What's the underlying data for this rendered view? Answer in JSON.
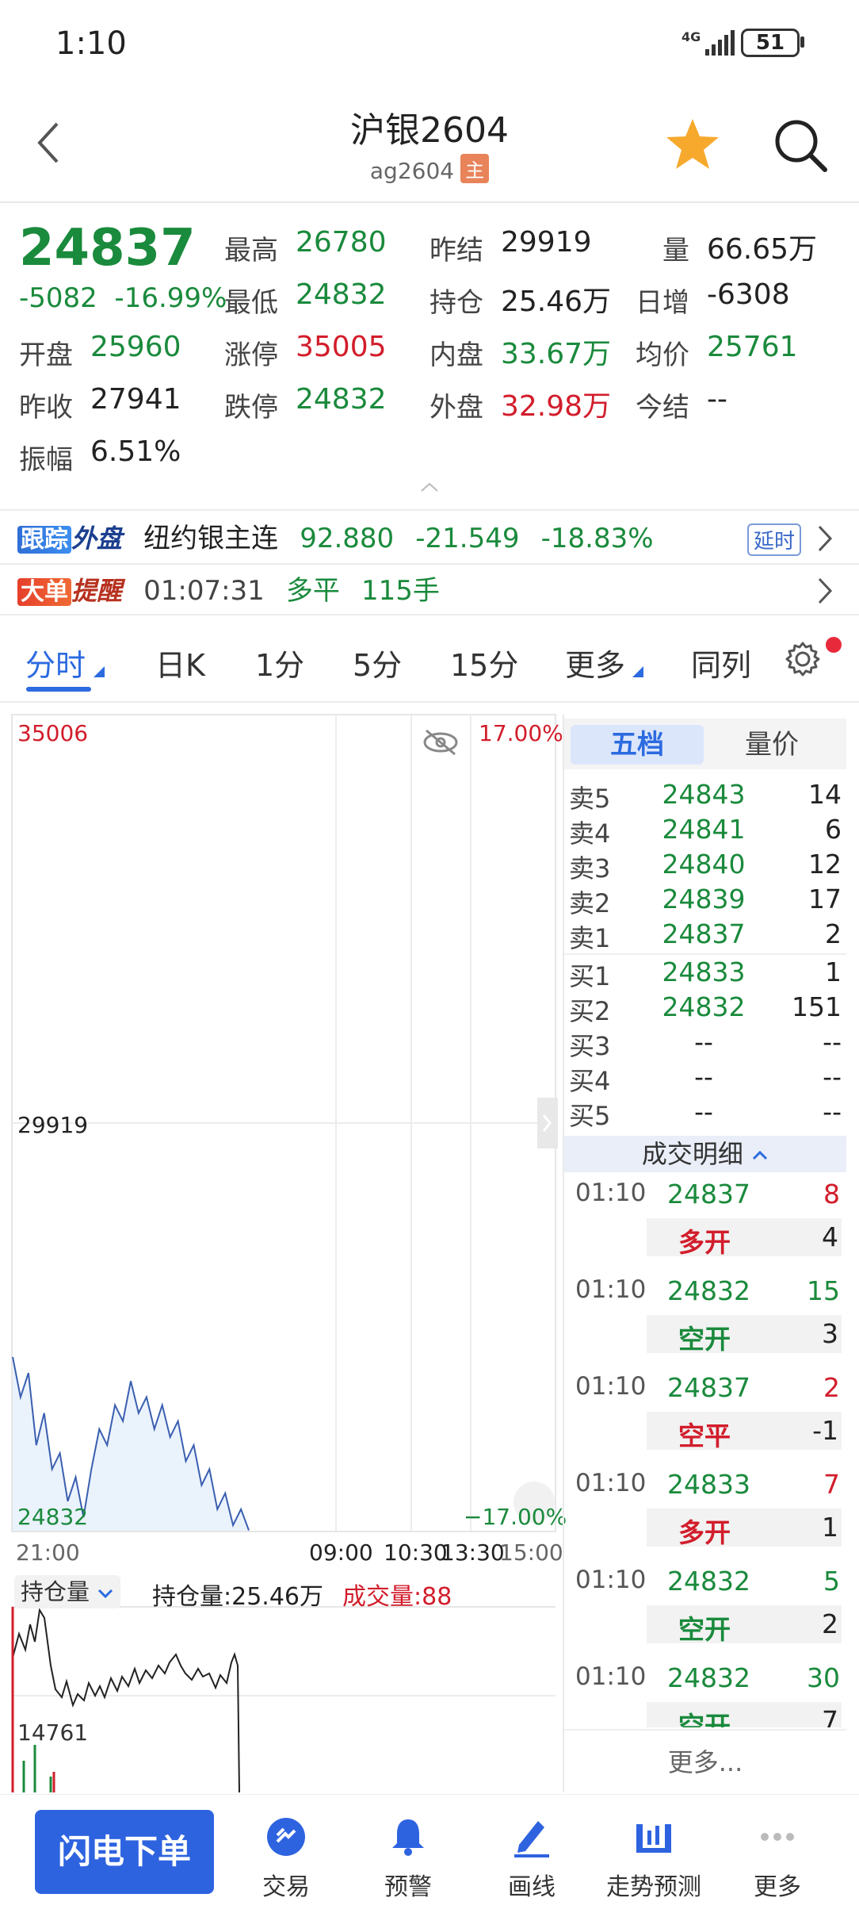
{
  "status": {
    "time": "1:10",
    "network": "4G",
    "battery": "51"
  },
  "header": {
    "title": "沪银2604",
    "symbol": "ag2604",
    "main_badge": "主"
  },
  "quote": {
    "last": "24837",
    "change": "-5082",
    "change_pct": "-16.99%",
    "fields": {
      "high_label": "最高",
      "high": "26780",
      "prev_settle_label": "昨结",
      "prev_settle": "29919",
      "volume_label": "量",
      "volume": "66.65万",
      "low_label": "最低",
      "low": "24832",
      "open_interest_label": "持仓",
      "open_interest": "25.46万",
      "daily_inc_label": "日增",
      "daily_inc": "-6308",
      "open_label": "开盘",
      "open": "25960",
      "limit_up_label": "涨停",
      "limit_up": "35005",
      "inner_label": "内盘",
      "inner": "33.67万",
      "avg_label": "均价",
      "avg": "25761",
      "prev_close_label": "昨收",
      "prev_close": "27941",
      "limit_down_label": "跌停",
      "limit_down": "24832",
      "outer_label": "外盘",
      "outer": "32.98万",
      "settle_label": "今结",
      "settle": "--",
      "amplitude_label": "振幅",
      "amplitude": "6.51%"
    }
  },
  "banner_track": {
    "tag1": "跟踪",
    "tag2": "外盘",
    "name": "纽约银主连",
    "price": "92.880",
    "change": "-21.549",
    "change_pct": "-18.83%",
    "delay": "延时"
  },
  "banner_big": {
    "tag1": "大单",
    "tag2": "提醒",
    "time": "01:07:31",
    "action": "多平",
    "qty": "115手"
  },
  "tabs": [
    "分时",
    "日K",
    "1分",
    "5分",
    "15分",
    "更多",
    "同列"
  ],
  "chart": {
    "top_price": "35006",
    "top_pct": "17.00%",
    "mid_price": "29919",
    "bottom_price": "24832",
    "bottom_pct": "−17.00%",
    "time_labels": [
      "21:00",
      "09:00",
      "10:30",
      "13:30",
      "15:00"
    ],
    "sub_select": "持仓量",
    "oi_text": "持仓量:25.46万",
    "vol_text": "成交量:88",
    "sub_axis_label": "14761"
  },
  "chart_data": {
    "type": "line",
    "title": "",
    "series": [
      {
        "values": [
          27000,
          26500,
          26800,
          25900,
          26300,
          25600,
          25800,
          25200,
          25500,
          25000,
          25600,
          26100,
          25900,
          26400,
          26200,
          26700,
          26300,
          26500,
          26100,
          26400,
          26000,
          26200,
          25700,
          25900,
          25400,
          25600,
          25100,
          25300,
          24900,
          25100,
          24837
        ]
      }
    ],
    "ylim": [
      24832,
      35006
    ],
    "reference": 29919,
    "xlabel": "",
    "ylabel": ""
  },
  "orderbook": {
    "tab_five": "五档",
    "tab_vp": "量价",
    "asks": [
      {
        "label": "卖5",
        "price": "24843",
        "vol": "14"
      },
      {
        "label": "卖4",
        "price": "24841",
        "vol": "6"
      },
      {
        "label": "卖3",
        "price": "24840",
        "vol": "12"
      },
      {
        "label": "卖2",
        "price": "24839",
        "vol": "17"
      },
      {
        "label": "卖1",
        "price": "24837",
        "vol": "2"
      }
    ],
    "bids": [
      {
        "label": "买1",
        "price": "24833",
        "vol": "1"
      },
      {
        "label": "买2",
        "price": "24832",
        "vol": "151"
      },
      {
        "label": "买3",
        "price": "--",
        "vol": "--"
      },
      {
        "label": "买4",
        "price": "--",
        "vol": "--"
      },
      {
        "label": "买5",
        "price": "--",
        "vol": "--"
      }
    ],
    "deal_header": "成交明细",
    "deals": [
      {
        "time": "01:10",
        "price": "24837",
        "vol": "8",
        "type": "多开",
        "sub": "4",
        "vol_color": "#d21d2b",
        "type_color": "#d21d2b"
      },
      {
        "time": "01:10",
        "price": "24832",
        "vol": "15",
        "type": "空开",
        "sub": "3",
        "vol_color": "#1a8a3c",
        "type_color": "#1a8a3c"
      },
      {
        "time": "01:10",
        "price": "24837",
        "vol": "2",
        "type": "空平",
        "sub": "-1",
        "vol_color": "#d21d2b",
        "type_color": "#d21d2b"
      },
      {
        "time": "01:10",
        "price": "24833",
        "vol": "7",
        "type": "多开",
        "sub": "1",
        "vol_color": "#d21d2b",
        "type_color": "#d21d2b"
      },
      {
        "time": "01:10",
        "price": "24832",
        "vol": "5",
        "type": "空开",
        "sub": "2",
        "vol_color": "#1a8a3c",
        "type_color": "#1a8a3c"
      },
      {
        "time": "01:10",
        "price": "24832",
        "vol": "30",
        "type": "空开",
        "sub": "7",
        "vol_color": "#1a8a3c",
        "type_color": "#1a8a3c"
      }
    ],
    "more": "更多..."
  },
  "bottom_nav": {
    "flash": "闪电下单",
    "items": [
      "交易",
      "预警",
      "画线",
      "走势预测",
      "更多"
    ]
  },
  "colors": {
    "up": "#d21d2b",
    "down": "#1a8a3c",
    "accent": "#2c6be0",
    "line": "#3a5fb0"
  }
}
